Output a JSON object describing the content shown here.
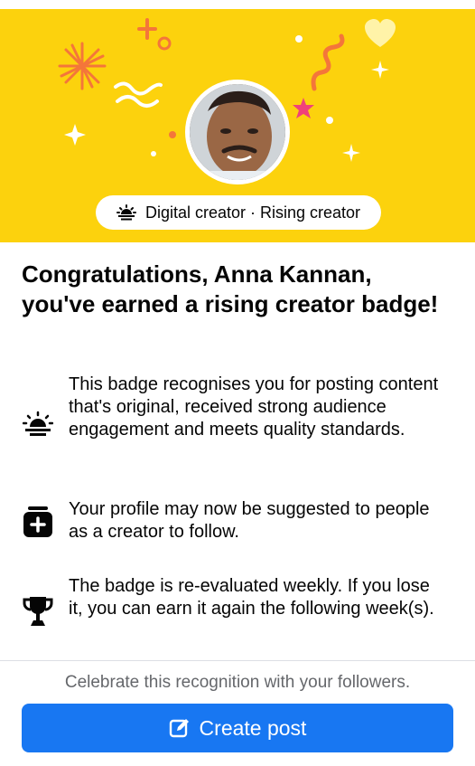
{
  "banner": {
    "background": "#fcd20d",
    "badge_pill": {
      "icon": "sunrise-icon",
      "label": "Digital creator · Rising creator"
    }
  },
  "heading": "Congratulations, Anna Kannan, you've earned a rising creator badge!",
  "benefits": [
    {
      "icon": "sunrise-icon",
      "text": "This badge recognises you for posting content that's original, received strong audience engagement and meets quality standards."
    },
    {
      "icon": "add-follow-icon",
      "text": "Your profile may now be suggested to people as a creator to follow."
    },
    {
      "icon": "trophy-icon",
      "text": "The badge is re-evaluated weekly. If you lose it, you can earn it again the following week(s)."
    }
  ],
  "footer": {
    "prompt": "Celebrate this recognition with your followers.",
    "cta_label": "Create post",
    "cta_icon": "edit-icon",
    "cta_color": "#1877f2"
  }
}
